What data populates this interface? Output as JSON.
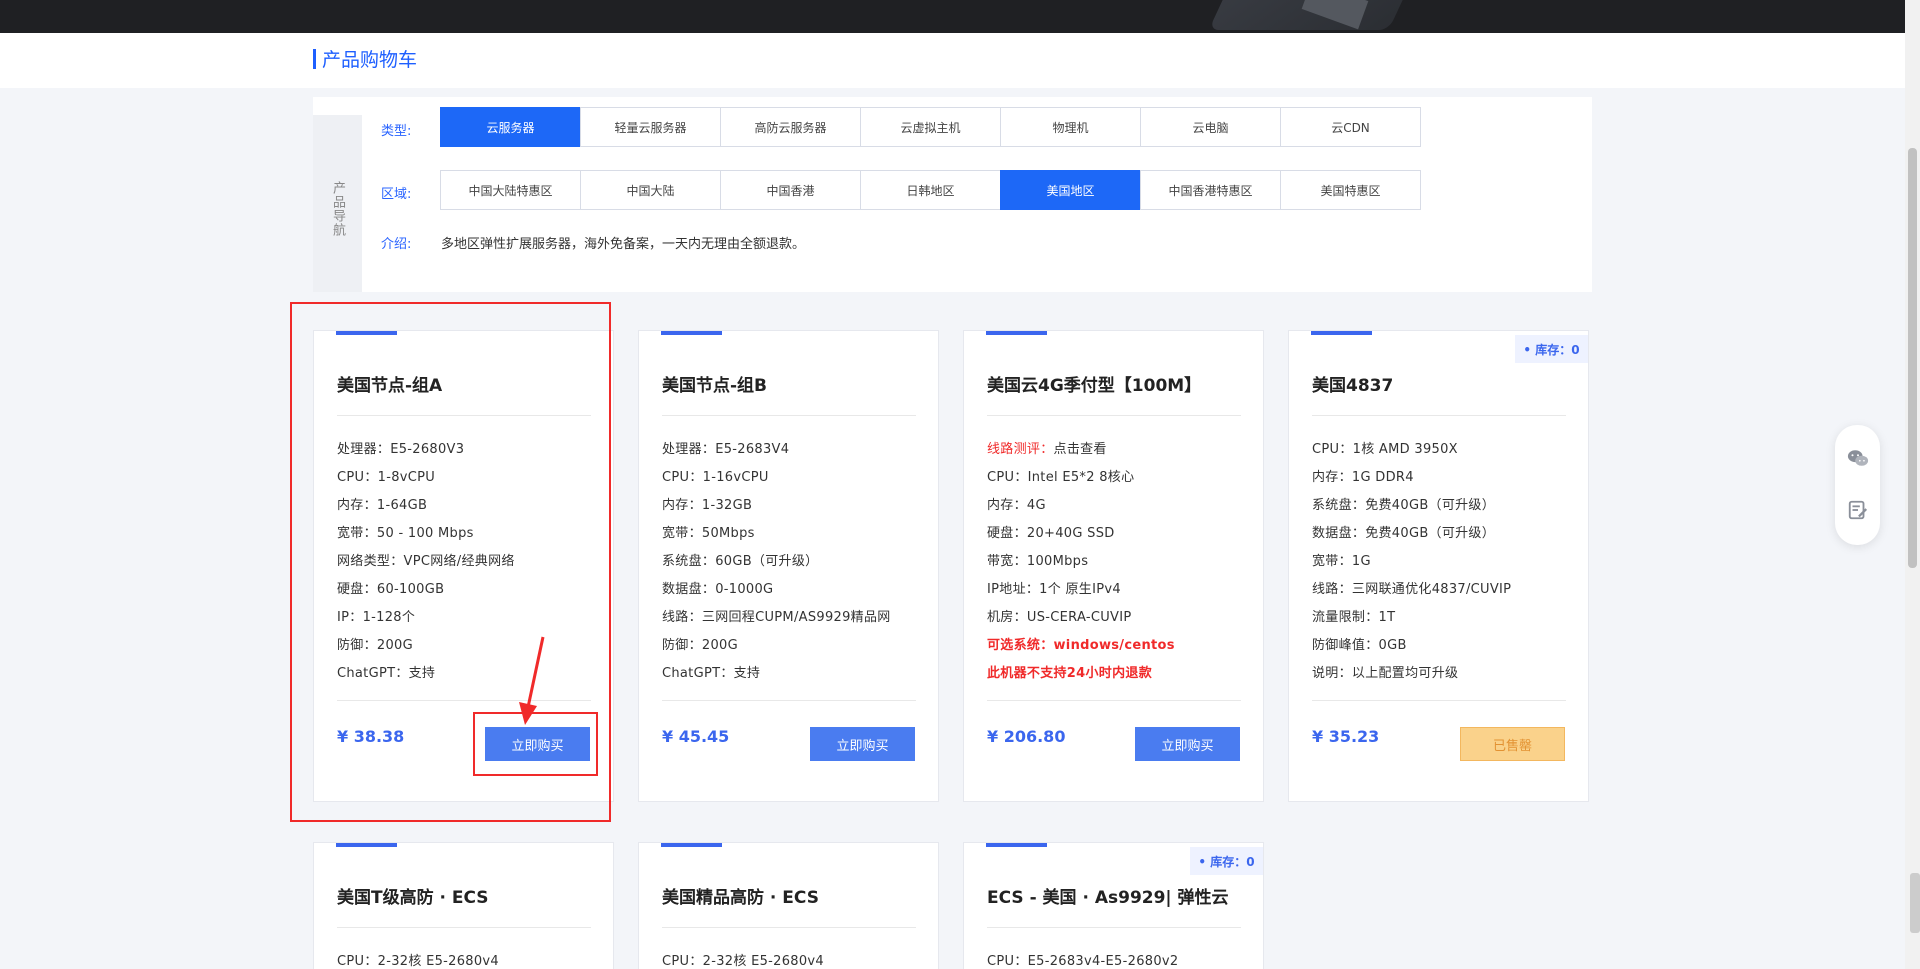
{
  "page": {
    "title": "产品购物车"
  },
  "nav": {
    "side_label": "产品导航",
    "type_label": "类型:",
    "region_label": "区域:",
    "intro_label": "介绍:",
    "types": [
      {
        "label": "云服务器",
        "active": true
      },
      {
        "label": "轻量云服务器",
        "active": false
      },
      {
        "label": "高防云服务器",
        "active": false
      },
      {
        "label": "云虚拟主机",
        "active": false
      },
      {
        "label": "物理机",
        "active": false
      },
      {
        "label": "云电脑",
        "active": false
      },
      {
        "label": "云CDN",
        "active": false
      }
    ],
    "regions": [
      {
        "label": "中国大陆特惠区",
        "active": false
      },
      {
        "label": "中国大陆",
        "active": false
      },
      {
        "label": "中国香港",
        "active": false
      },
      {
        "label": "日韩地区",
        "active": false
      },
      {
        "label": "美国地区",
        "active": true
      },
      {
        "label": "中国香港特惠区",
        "active": false
      },
      {
        "label": "美国特惠区",
        "active": false
      }
    ],
    "intro": "多地区弹性扩展服务器，海外免备案，一天内无理由全额退款。"
  },
  "products": [
    {
      "title": "美国节点-组A",
      "specs": [
        "处理器：E5-2680V3",
        "CPU：1-8vCPU",
        "内存：1-64GB",
        "宽带：50 - 100 Mbps",
        "网络类型：VPC网络/经典网络",
        "硬盘：60-100GB",
        "IP：1-128个",
        "防御：200G",
        "ChatGPT：支持"
      ],
      "price": "¥ 38.38",
      "button": "立即购买"
    },
    {
      "title": "美国节点-组B",
      "specs": [
        "处理器：E5-2683V4",
        "CPU：1-16vCPU",
        "内存：1-32GB",
        "宽带：50Mbps",
        "系统盘：60GB（可升级）",
        "数据盘：0-1000G",
        "线路：三网回程CUPM/AS9929精品网",
        "防御：200G",
        "ChatGPT：支持"
      ],
      "price": "¥ 45.45",
      "button": "立即购买"
    },
    {
      "title": "美国云4G季付型【100M】",
      "spec_prefix": "线路测评：",
      "spec_prefix_rest": "点击查看",
      "specs": [
        "CPU：Intel E5*2 8核心",
        "内存：4G",
        "硬盘：20+40G SSD",
        "带宽：100Mbps",
        "IP地址：1个 原生IPv4",
        "机房：US-CERA-CUVIP"
      ],
      "red_specs": [
        "可选系统：windows/centos",
        "此机器不支持24小时内退款"
      ],
      "price": "¥ 206.80",
      "button": "立即购买"
    },
    {
      "title": "美国4837",
      "stock": "• 库存：0",
      "specs": [
        "CPU：1核 AMD 3950X",
        "内存：1G DDR4",
        "系统盘：免费40GB（可升级）",
        "数据盘：免费40GB（可升级）",
        "宽带：1G",
        "线路：三网联通优化4837/CUVIP",
        "流量限制：1T",
        "防御峰值：0GB",
        "说明：以上配置均可升级"
      ],
      "price": "¥ 35.23",
      "button": "已售罄"
    },
    {
      "title": "美国T级高防 · ECS",
      "specs": [
        "CPU：2-32核 E5-2680v4"
      ]
    },
    {
      "title": "美国精品高防 · ECS",
      "specs": [
        "CPU：2-32核 E5-2680v4"
      ]
    },
    {
      "title": "ECS - 美国 · As9929| 弹性云",
      "stock": "• 库存：0",
      "specs": [
        "CPU：E5-2683v4-E5-2680v2"
      ]
    }
  ],
  "colors": {
    "accent": "#1d68f7",
    "price": "#3b66ee",
    "annotation": "#f02a2a"
  },
  "icons": {
    "float1": "wechat-icon",
    "float2": "edit-note-icon"
  }
}
